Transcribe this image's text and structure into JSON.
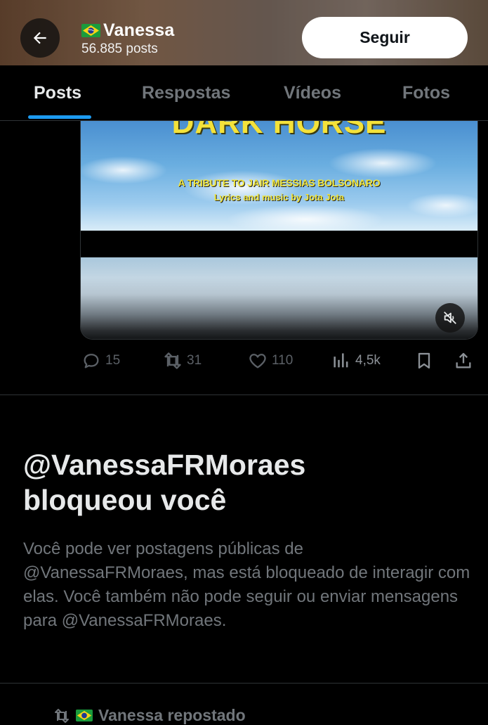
{
  "header": {
    "name": "Vanessa",
    "posts_count": "56.885 posts",
    "follow_label": "Seguir",
    "back_icon": "arrow-left-icon",
    "flag_icon": "brazil-flag-icon"
  },
  "tabs": [
    {
      "label": "Posts",
      "active": true
    },
    {
      "label": "Respostas",
      "active": false
    },
    {
      "label": "Vídeos",
      "active": false
    },
    {
      "label": "Fotos",
      "active": false
    }
  ],
  "media": {
    "title": "DARK HORSE",
    "subtitle1": "A TRIBUTE TO JAIR MESSIAS BOLSONARO",
    "subtitle2": "Lyrics and music by Jota Jota",
    "mute_icon": "muted-speaker-icon"
  },
  "actions": {
    "replies": "15",
    "reposts": "31",
    "likes": "110",
    "views": "4,5k"
  },
  "block_notice": {
    "title_line1": "@VanessaFRMoraes",
    "title_line2": "bloqueou você",
    "description": "Você pode ver postagens públicas de @VanessaFRMoraes, mas está bloqueado de interagir com elas. Você também não pode seguir ou enviar mensagens para @VanessaFRMoraes."
  },
  "next_post": {
    "repost_label": "Vanessa repostado"
  },
  "colors": {
    "accent": "#1d9bf0",
    "background": "#000000",
    "muted_text": "#71767b"
  }
}
